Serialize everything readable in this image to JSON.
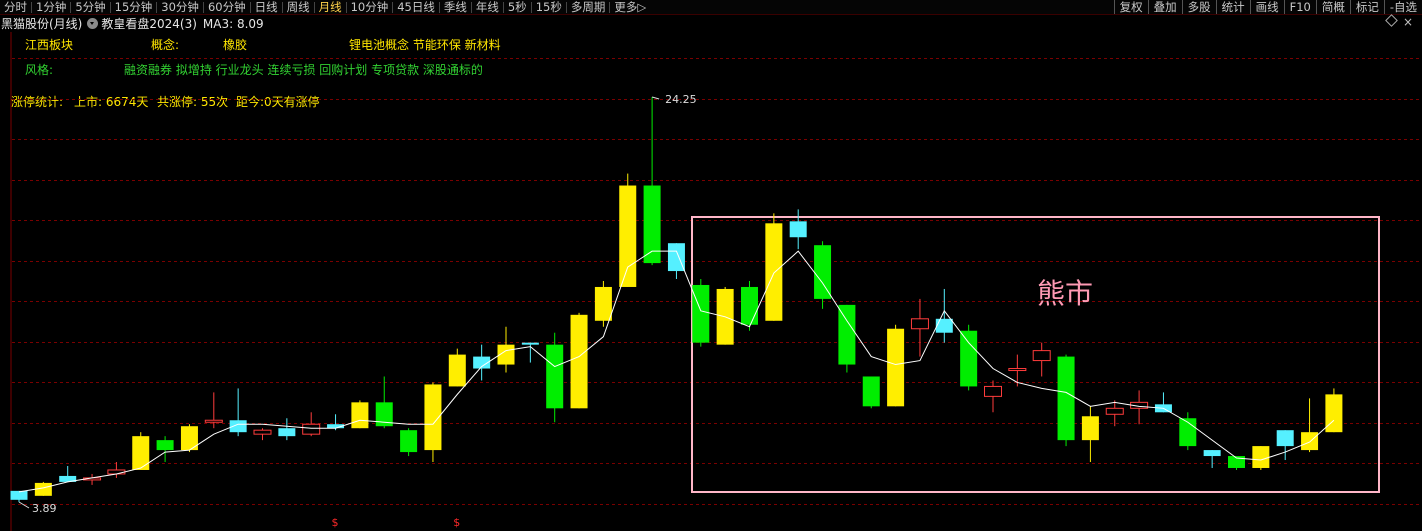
{
  "toolbar": {
    "items": [
      "分时",
      "1分钟",
      "5分钟",
      "15分钟",
      "30分钟",
      "60分钟",
      "日线",
      "周线",
      "月线",
      "10分钟",
      "45日线",
      "季线",
      "年线",
      "5秒",
      "15秒",
      "多周期",
      "更多"
    ],
    "active": "月线",
    "more_suffix": "▷",
    "right_items": [
      "复权",
      "叠加",
      "多股",
      "统计",
      "画线",
      "F10",
      "简概",
      "标记",
      "-自选"
    ]
  },
  "header": {
    "stock": "黑猫股份(月线)",
    "indicator": "教皇看盘2024(3)",
    "ma_label": "MA3: 8.09",
    "close_symbol": "×"
  },
  "info": {
    "sector_label": "江西板块",
    "concept_label": "概念:",
    "concept_value": "橡胶",
    "concept_tags": "锂电池概念 节能环保 新材料",
    "style_label": "风格:",
    "style_tags": "融资融券 拟增持 行业龙头 连续亏损 回购计划 专项贷款 深股通标的",
    "limit_stats": "涨停统计:",
    "listed": "上市: 6674天",
    "total_limit": "共涨停: 55次",
    "days_since": "距今:0天有涨停"
  },
  "annotation": "熊市",
  "colors": {
    "up_yellow": "#ffee00",
    "up_cyan": "#55f0ff",
    "down_green": "#00ee00",
    "hollow_red": "#ff3c3c",
    "ma_line": "#ffffff",
    "grid": "#7a0000",
    "box": "#ffb6c8"
  },
  "chart_data": {
    "type": "candlestick",
    "period": "monthly",
    "max_label": "24.25",
    "min_label": "3.89",
    "max_value": 24.25,
    "min_value": 3.89,
    "signal_marker": "$",
    "signal_bar_indexes": [
      13,
      18
    ],
    "candles": [
      {
        "o": 4.0,
        "h": 4.25,
        "l": 3.89,
        "c": 4.45,
        "k": "c"
      },
      {
        "o": 4.2,
        "h": 4.9,
        "l": 4.2,
        "c": 4.85,
        "k": "y"
      },
      {
        "o": 4.9,
        "h": 5.7,
        "l": 4.9,
        "c": 5.2,
        "k": "c"
      },
      {
        "o": 5.0,
        "h": 5.3,
        "l": 4.75,
        "c": 5.1,
        "k": "r"
      },
      {
        "o": 5.3,
        "h": 5.9,
        "l": 5.1,
        "c": 5.5,
        "k": "r"
      },
      {
        "o": 5.5,
        "h": 7.4,
        "l": 5.5,
        "c": 7.2,
        "k": "y"
      },
      {
        "o": 7.0,
        "h": 7.2,
        "l": 5.9,
        "c": 6.5,
        "k": "g"
      },
      {
        "o": 6.5,
        "h": 7.8,
        "l": 6.4,
        "c": 7.7,
        "k": "y"
      },
      {
        "o": 7.9,
        "h": 9.4,
        "l": 7.6,
        "c": 8.0,
        "k": "r"
      },
      {
        "o": 7.4,
        "h": 9.6,
        "l": 7.2,
        "c": 8.0,
        "k": "c"
      },
      {
        "o": 7.3,
        "h": 7.6,
        "l": 7.0,
        "c": 7.5,
        "k": "r"
      },
      {
        "o": 7.2,
        "h": 8.1,
        "l": 7.0,
        "c": 7.6,
        "k": "c"
      },
      {
        "o": 7.3,
        "h": 8.4,
        "l": 7.2,
        "c": 7.8,
        "k": "r"
      },
      {
        "o": 7.6,
        "h": 8.3,
        "l": 7.5,
        "c": 7.8,
        "k": "c"
      },
      {
        "o": 7.6,
        "h": 9.0,
        "l": 7.6,
        "c": 8.9,
        "k": "y"
      },
      {
        "o": 8.9,
        "h": 10.2,
        "l": 7.6,
        "c": 7.7,
        "k": "g"
      },
      {
        "o": 7.5,
        "h": 7.6,
        "l": 6.2,
        "c": 6.4,
        "k": "g"
      },
      {
        "o": 6.5,
        "h": 9.9,
        "l": 5.9,
        "c": 9.8,
        "k": "y"
      },
      {
        "o": 9.7,
        "h": 11.6,
        "l": 9.7,
        "c": 11.3,
        "k": "y"
      },
      {
        "o": 10.6,
        "h": 11.8,
        "l": 10.0,
        "c": 11.2,
        "k": "c"
      },
      {
        "o": 10.8,
        "h": 12.7,
        "l": 10.4,
        "c": 11.8,
        "k": "y"
      },
      {
        "o": 11.9,
        "h": 11.9,
        "l": 10.9,
        "c": 11.8,
        "k": "c"
      },
      {
        "o": 11.8,
        "h": 12.4,
        "l": 7.9,
        "c": 8.6,
        "k": "g"
      },
      {
        "o": 8.6,
        "h": 13.4,
        "l": 8.6,
        "c": 13.3,
        "k": "y"
      },
      {
        "o": 13.0,
        "h": 15.0,
        "l": 12.7,
        "c": 14.7,
        "k": "y"
      },
      {
        "o": 14.7,
        "h": 20.4,
        "l": 14.7,
        "c": 19.8,
        "k": "y"
      },
      {
        "o": 19.8,
        "h": 24.25,
        "l": 15.8,
        "c": 15.9,
        "k": "g"
      },
      {
        "o": 15.5,
        "h": 16.3,
        "l": 15.1,
        "c": 16.9,
        "k": "c"
      },
      {
        "o": 14.8,
        "h": 15.1,
        "l": 11.7,
        "c": 11.9,
        "k": "g"
      },
      {
        "o": 11.8,
        "h": 14.7,
        "l": 11.8,
        "c": 14.6,
        "k": "y"
      },
      {
        "o": 14.7,
        "h": 15.0,
        "l": 12.5,
        "c": 12.8,
        "k": "g"
      },
      {
        "o": 13.0,
        "h": 18.4,
        "l": 13.0,
        "c": 17.9,
        "k": "y"
      },
      {
        "o": 17.2,
        "h": 18.6,
        "l": 16.6,
        "c": 18.0,
        "k": "c"
      },
      {
        "o": 16.8,
        "h": 17.0,
        "l": 13.6,
        "c": 14.1,
        "k": "g"
      },
      {
        "o": 13.8,
        "h": 13.8,
        "l": 10.4,
        "c": 10.8,
        "k": "g"
      },
      {
        "o": 10.2,
        "h": 10.2,
        "l": 8.6,
        "c": 8.7,
        "k": "g"
      },
      {
        "o": 8.7,
        "h": 12.8,
        "l": 8.7,
        "c": 12.6,
        "k": "y"
      },
      {
        "o": 12.6,
        "h": 14.1,
        "l": 11.2,
        "c": 13.1,
        "k": "r"
      },
      {
        "o": 12.4,
        "h": 14.6,
        "l": 11.9,
        "c": 13.1,
        "k": "c"
      },
      {
        "o": 12.5,
        "h": 12.8,
        "l": 9.5,
        "c": 9.7,
        "k": "g"
      },
      {
        "o": 9.7,
        "h": 10.0,
        "l": 8.4,
        "c": 9.2,
        "k": "r"
      },
      {
        "o": 10.5,
        "h": 11.3,
        "l": 9.7,
        "c": 10.6,
        "k": "r"
      },
      {
        "o": 11.5,
        "h": 11.9,
        "l": 10.2,
        "c": 11.0,
        "k": "r"
      },
      {
        "o": 11.2,
        "h": 11.3,
        "l": 6.7,
        "c": 7.0,
        "k": "g"
      },
      {
        "o": 7.0,
        "h": 8.7,
        "l": 5.9,
        "c": 8.2,
        "k": "y"
      },
      {
        "o": 8.3,
        "h": 9.0,
        "l": 7.7,
        "c": 8.6,
        "k": "r"
      },
      {
        "o": 8.6,
        "h": 9.5,
        "l": 7.8,
        "c": 8.9,
        "k": "r"
      },
      {
        "o": 8.4,
        "h": 9.4,
        "l": 8.4,
        "c": 8.8,
        "k": "c"
      },
      {
        "o": 8.1,
        "h": 8.4,
        "l": 6.5,
        "c": 6.7,
        "k": "g"
      },
      {
        "o": 6.2,
        "h": 6.5,
        "l": 5.6,
        "c": 6.5,
        "k": "c"
      },
      {
        "o": 6.2,
        "h": 6.2,
        "l": 5.5,
        "c": 5.6,
        "k": "g"
      },
      {
        "o": 5.6,
        "h": 6.7,
        "l": 5.5,
        "c": 6.7,
        "k": "y"
      },
      {
        "o": 6.7,
        "h": 6.7,
        "l": 6.0,
        "c": 7.5,
        "k": "c"
      },
      {
        "o": 6.5,
        "h": 9.1,
        "l": 6.4,
        "c": 7.4,
        "k": "y"
      },
      {
        "o": 7.4,
        "h": 9.6,
        "l": 7.4,
        "c": 9.3,
        "k": "y"
      }
    ],
    "ma3": [
      4.4,
      4.6,
      4.9,
      5.1,
      5.3,
      5.6,
      6.4,
      6.5,
      7.3,
      7.8,
      7.8,
      7.7,
      7.6,
      7.6,
      8.0,
      7.9,
      7.8,
      7.8,
      9.3,
      10.7,
      11.5,
      11.7,
      10.7,
      11.2,
      12.2,
      15.7,
      16.5,
      16.5,
      13.5,
      13.2,
      12.7,
      15.4,
      16.5,
      14.9,
      13.0,
      11.2,
      10.8,
      11.0,
      13.5,
      11.9,
      10.6,
      9.9,
      9.6,
      9.4,
      8.7,
      8.9,
      8.7,
      8.6,
      7.9,
      7.0,
      6.1,
      6.0,
      6.4,
      6.9,
      8.0
    ]
  }
}
